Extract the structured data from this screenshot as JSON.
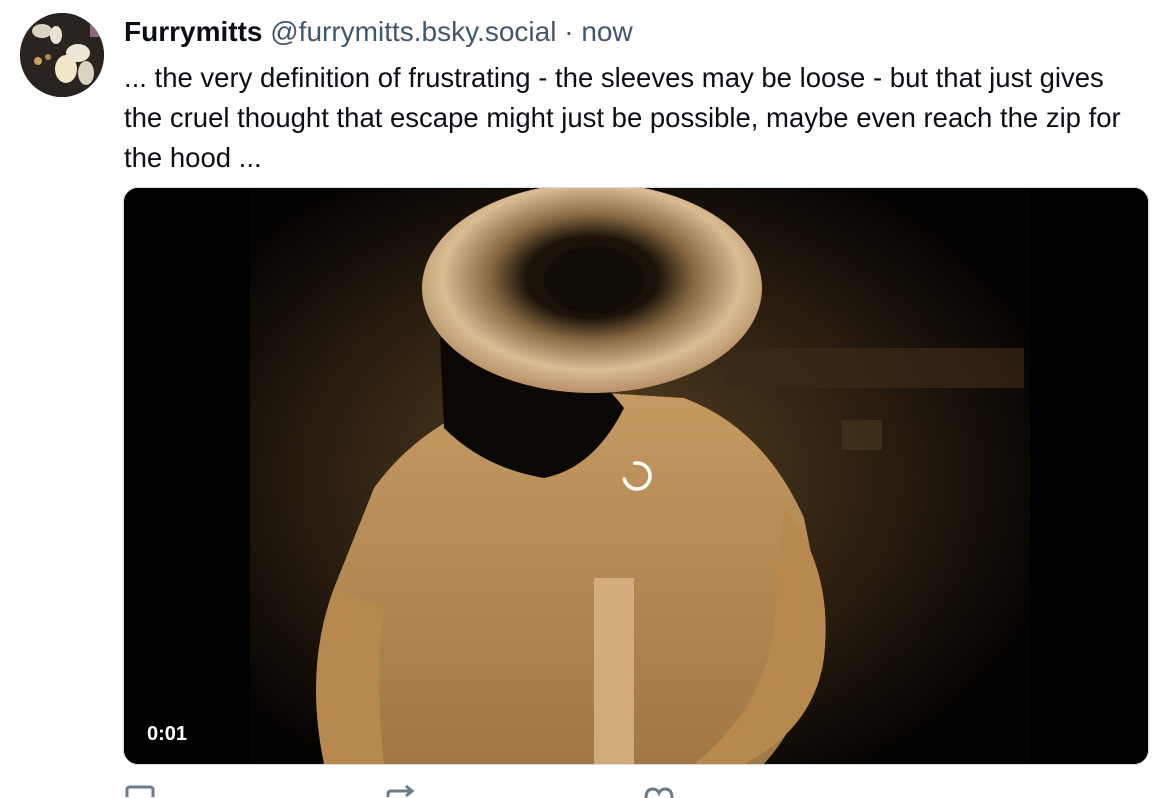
{
  "author": {
    "display_name": "Furrymitts",
    "handle": "@furrymitts.bsky.social",
    "separator": "·",
    "time": "now",
    "avatar_icon": "avatar-image"
  },
  "post": {
    "text": "... the very definition of frustrating - the sleeves may be loose - but that just gives the cruel thought that escape might just be possible, maybe even reach the zip for the hood ..."
  },
  "video": {
    "timestamp": "0:01",
    "state": "loading",
    "spinner_icon": "loading-spinner-icon"
  },
  "actions": [
    {
      "name": "reply-button",
      "icon": "reply-icon"
    },
    {
      "name": "repost-button",
      "icon": "repost-icon"
    },
    {
      "name": "like-button",
      "icon": "heart-icon"
    }
  ],
  "colors": {
    "text_primary": "#0b0f14",
    "text_secondary": "#42576c",
    "border": "#d4dbe2"
  }
}
